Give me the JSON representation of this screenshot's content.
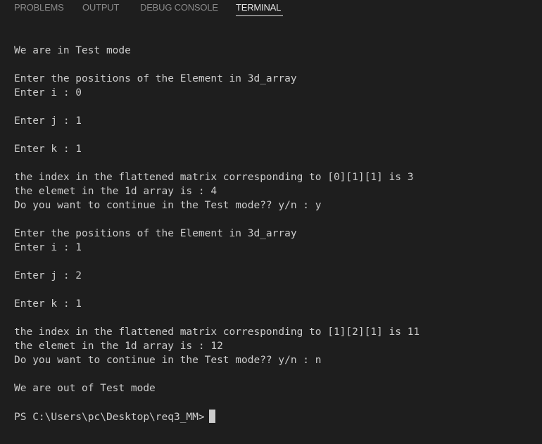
{
  "tabs": [
    {
      "label": "PROBLEMS",
      "active": false
    },
    {
      "label": "OUTPUT",
      "active": false
    },
    {
      "label": "DEBUG CONSOLE",
      "active": false
    },
    {
      "label": "TERMINAL",
      "active": true
    }
  ],
  "terminal": {
    "lines": [
      "We are in Test mode",
      "",
      "Enter the positions of the Element in 3d_array",
      "Enter i : 0",
      "",
      "Enter j : 1",
      "",
      "Enter k : 1",
      "",
      "the index in the flattened matrix corresponding to [0][1][1] is 3",
      "the elemet in the 1d array is : 4",
      "Do you want to continue in the Test mode?? y/n : y",
      "",
      "Enter the positions of the Element in 3d_array",
      "Enter i : 1",
      "",
      "Enter j : 2",
      "",
      "Enter k : 1",
      "",
      "the index in the flattened matrix corresponding to [1][2][1] is 11",
      "the elemet in the 1d array is : 12",
      "Do you want to continue in the Test mode?? y/n : n",
      "",
      "We are out of Test mode",
      ""
    ],
    "prompt": "PS C:\\Users\\pc\\Desktop\\req3_MM>"
  },
  "colors": {
    "background": "#1e1e1e",
    "text": "#cccccc",
    "tab_inactive": "#8b8b8b",
    "tab_active": "#e7e7e7"
  }
}
